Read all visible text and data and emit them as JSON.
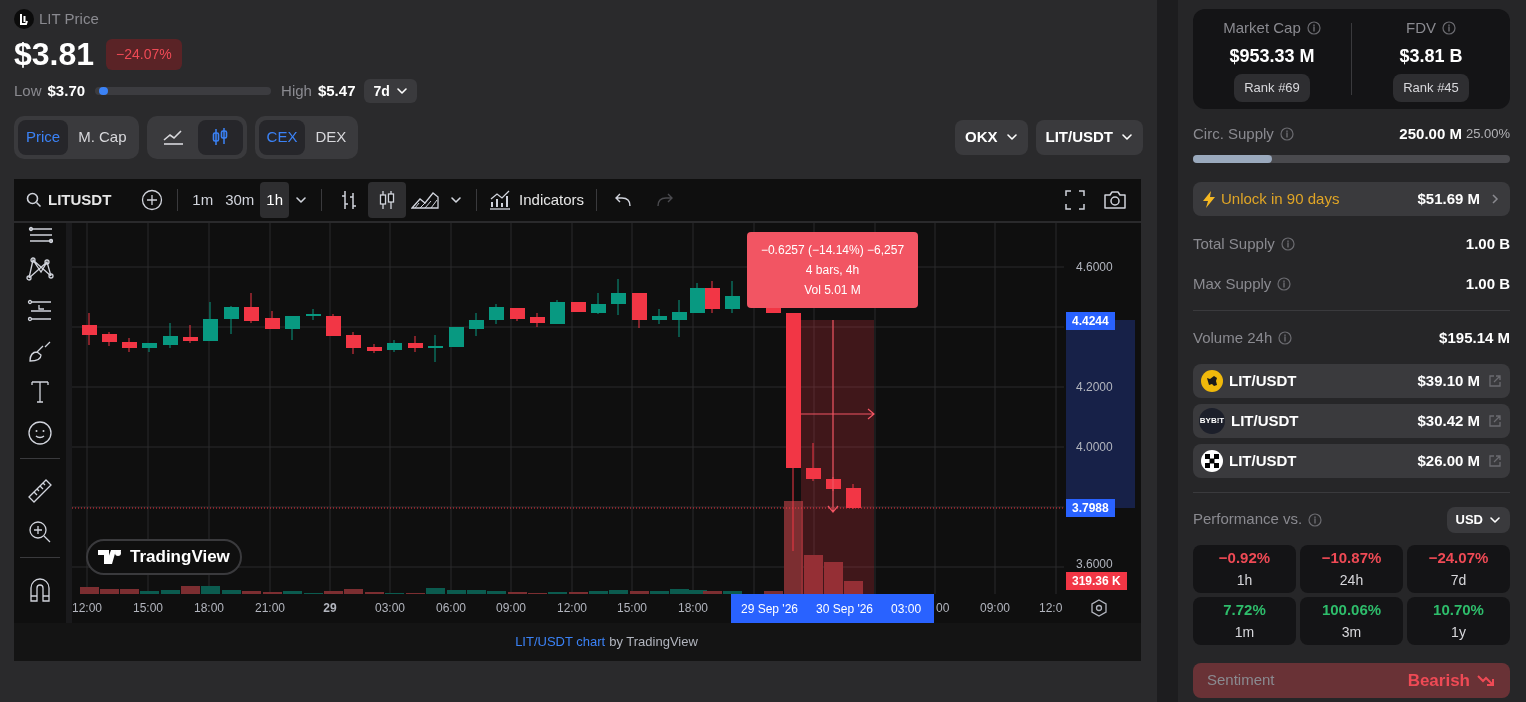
{
  "header": {
    "title": "LIT Price",
    "price": "$3.81",
    "change": "−24.07%",
    "low_label": "Low",
    "low": "$3.70",
    "high_label": "High",
    "high": "$5.47",
    "range_marker": {
      "level": 0.02
    },
    "period": "7d"
  },
  "toggles": [
    {
      "options": [
        {
          "label": "Price",
          "selected": true
        },
        {
          "label": "M. Cap",
          "selected": false
        }
      ]
    },
    {
      "options": [
        {
          "kind": "line",
          "selected": false
        },
        {
          "kind": "candles",
          "selected": true
        }
      ]
    },
    {
      "options": [
        {
          "label": "CEX",
          "selected": true
        },
        {
          "label": "DEX",
          "selected": false
        }
      ]
    }
  ],
  "exchange": "OKX",
  "pair": "LIT/USDT",
  "chart": {
    "toolbar": {
      "symbol": "LITUSDT",
      "intervals": [
        {
          "label": "1m",
          "selected": false
        },
        {
          "label": "30m",
          "selected": false
        },
        {
          "label": "1h",
          "selected": true
        }
      ],
      "chart_types": [
        {
          "kind": "bars",
          "selected": false
        },
        {
          "kind": "candles",
          "selected": true
        },
        {
          "kind": "area",
          "selected": false
        }
      ],
      "indicators": "Indicators"
    },
    "price_ticks": [
      "4.6000",
      "4.2000",
      "4.0000",
      "3.6000"
    ],
    "markers": [
      {
        "label": "4.4244",
        "kind": "price"
      },
      {
        "label": "3.7988",
        "kind": "price"
      },
      {
        "label": "319.36 K",
        "kind": "volume"
      }
    ],
    "measure": [
      "−0.6257 (−14.14%) −6,257",
      "4 bars, 4h",
      "Vol 5.01 M"
    ],
    "time_ticks": [
      {
        "label": "12:00",
        "bold": false
      },
      {
        "label": "15:00",
        "bold": false
      },
      {
        "label": "18:00",
        "bold": false
      },
      {
        "label": "21:00",
        "bold": false
      },
      {
        "label": "29",
        "bold": true
      },
      {
        "label": "03:00",
        "bold": false
      },
      {
        "label": "06:00",
        "bold": false
      },
      {
        "label": "09:00",
        "bold": false
      },
      {
        "label": "12:00",
        "bold": false
      },
      {
        "label": "15:00",
        "bold": false
      },
      {
        "label": "18:00",
        "bold": false
      }
    ],
    "range_labels": [
      "29 Sep '26",
      "30 Sep '26",
      "03:00"
    ],
    "time_ticks_after": [
      "00",
      "09:00",
      "12:0"
    ],
    "badge": "TradingView",
    "footer_link": "LIT/USDT chart",
    "footer_text": "by TradingView"
  },
  "stats": [
    {
      "label": "Market Cap",
      "value": "$953.33 M",
      "rank": "Rank #69"
    },
    {
      "label": "FDV",
      "value": "$3.81 B",
      "rank": "Rank #45"
    }
  ],
  "circ_supply": {
    "label": "Circ. Supply",
    "value": "250.00 M",
    "percent": "25.00%",
    "level": 0.25
  },
  "unlock": {
    "label": "Unlock in 90 days",
    "value": "$51.69 M"
  },
  "supply_rows": [
    {
      "label": "Total Supply",
      "value": "1.00 B"
    },
    {
      "label": "Max Supply",
      "value": "1.00 B"
    }
  ],
  "volume": {
    "label": "Volume 24h",
    "value": "$195.14 M"
  },
  "markets": [
    {
      "kind": "yellow",
      "pair": "LIT/USDT",
      "volume": "$39.10 M"
    },
    {
      "kind": "wordmark",
      "logo_text": "BYB!T",
      "pair": "LIT/USDT",
      "volume": "$30.42 M"
    },
    {
      "kind": "checker",
      "pair": "LIT/USDT",
      "volume": "$26.00 M"
    }
  ],
  "performance": {
    "label": "Performance vs.",
    "currency": "USD",
    "cells": [
      {
        "value": "−0.92%",
        "period": "1h",
        "color": "#ef4a55"
      },
      {
        "value": "−10.87%",
        "period": "24h",
        "color": "#ef4a55"
      },
      {
        "value": "−24.07%",
        "period": "7d",
        "color": "#ef4a55"
      },
      {
        "value": "7.72%",
        "period": "1m",
        "color": "#2ebd6b"
      },
      {
        "value": "100.06%",
        "period": "3m",
        "color": "#2ebd6b"
      },
      {
        "value": "10.70%",
        "period": "1y",
        "color": "#2ebd6b"
      }
    ]
  },
  "sentiment": {
    "label": "Sentiment",
    "value": "Bearish",
    "color": "#ef4a55"
  }
}
